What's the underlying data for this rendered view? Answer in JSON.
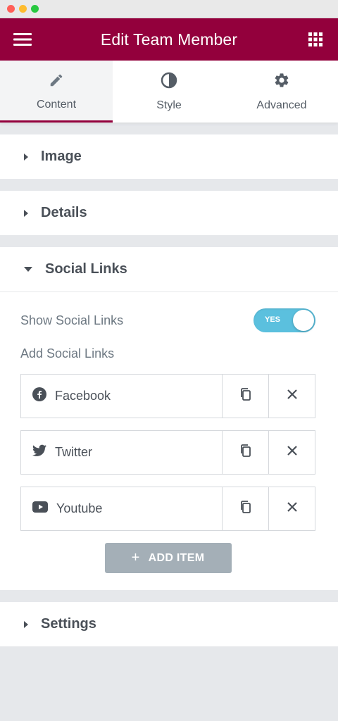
{
  "header": {
    "title": "Edit Team Member"
  },
  "tabs": [
    {
      "label": "Content",
      "icon": "pencil-icon",
      "active": true
    },
    {
      "label": "Style",
      "icon": "half-circle-icon",
      "active": false
    },
    {
      "label": "Advanced",
      "icon": "gear-icon",
      "active": false
    }
  ],
  "sections": {
    "image": {
      "label": "Image"
    },
    "details": {
      "label": "Details"
    },
    "social": {
      "label": "Social Links",
      "show_label": "Show Social Links",
      "toggle_value": "YES",
      "add_label": "Add Social Links",
      "items": [
        {
          "label": "Facebook",
          "icon": "facebook-icon"
        },
        {
          "label": "Twitter",
          "icon": "twitter-icon"
        },
        {
          "label": "Youtube",
          "icon": "youtube-icon"
        }
      ],
      "add_item_label": "ADD ITEM"
    },
    "settings": {
      "label": "Settings"
    }
  },
  "colors": {
    "brand": "#93003c",
    "toggle": "#5bc0de",
    "add_button": "#a4afb7"
  }
}
